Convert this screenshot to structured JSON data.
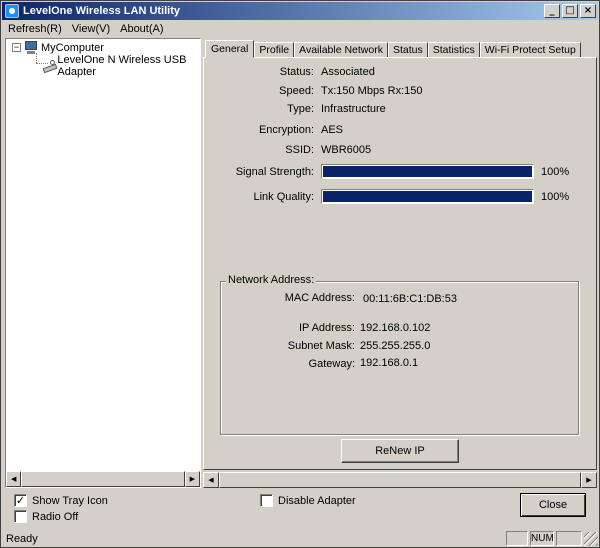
{
  "window": {
    "title": "LevelOne Wireless LAN Utility"
  },
  "titlebar_buttons": {
    "minimize": "_",
    "maximize": "□",
    "close": "×"
  },
  "menu": [
    {
      "label": "Refresh(R)"
    },
    {
      "label": "View(V)"
    },
    {
      "label": "About(A)"
    }
  ],
  "tree": {
    "root": {
      "label": "MyComputer",
      "expander": "−"
    },
    "child": {
      "label": "LevelOne N Wireless USB Adapter"
    }
  },
  "tabs": [
    {
      "label": "General",
      "active": true
    },
    {
      "label": "Profile"
    },
    {
      "label": "Available Network"
    },
    {
      "label": "Status"
    },
    {
      "label": "Statistics"
    },
    {
      "label": "Wi-Fi Protect Setup"
    }
  ],
  "general": {
    "status": {
      "label": "Status:",
      "value": "Associated"
    },
    "speed": {
      "label": "Speed:",
      "value": "Tx:150 Mbps Rx:150"
    },
    "type": {
      "label": "Type:",
      "value": "Infrastructure"
    },
    "encryption": {
      "label": "Encryption:",
      "value": "AES"
    },
    "ssid": {
      "label": "SSID:",
      "value": "WBR6005"
    },
    "signal": {
      "label": "Signal Strength:",
      "percent_text": "100%",
      "level": 1.0
    },
    "link": {
      "label": "Link Quality:",
      "percent_text": "100%",
      "level": 1.0
    }
  },
  "network": {
    "group_title": "Network Address:",
    "mac": {
      "label": "MAC Address:",
      "value": "00:11:6B:C1:DB:53"
    },
    "ip": {
      "label": "IP Address:",
      "value": "192.168.0.102"
    },
    "mask": {
      "label": "Subnet Mask:",
      "value": "255.255.255.0"
    },
    "gateway": {
      "label": "Gateway:",
      "value": "192.168.0.1"
    },
    "renew_label": "ReNew IP"
  },
  "bottom": {
    "show_tray": {
      "label": "Show Tray Icon",
      "checked": true
    },
    "radio_off": {
      "label": "Radio Off",
      "checked": false
    },
    "disable_adapter": {
      "label": "Disable Adapter",
      "checked": false
    },
    "close_label": "Close"
  },
  "statusbar": {
    "text": "Ready",
    "num": "NUM"
  },
  "colors": {
    "title_start": "#0a246a",
    "title_end": "#a6caf0",
    "bar_fill": "#0a246a",
    "face": "#d4d0c8"
  }
}
